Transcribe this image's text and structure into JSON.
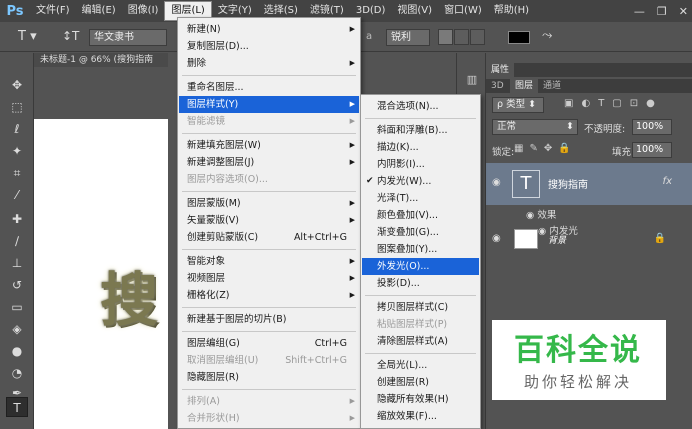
{
  "app": {
    "logo": "Ps"
  },
  "menubar": {
    "items": [
      "文件(F)",
      "编辑(E)",
      "图像(I)",
      "图层(L)",
      "文字(Y)",
      "选择(S)",
      "滤镜(T)",
      "3D(D)",
      "视图(V)",
      "窗口(W)",
      "帮助(H)"
    ],
    "active_index": 3
  },
  "options": {
    "font_family": "华文隶书",
    "aa_label": "a",
    "aa_method": "锐利"
  },
  "document": {
    "tab_title": "未标题-1 @ 66% (搜狗指南",
    "canvas_text": "搜"
  },
  "layer_menu": {
    "items": [
      {
        "label": "新建(N)",
        "arrow": true
      },
      {
        "label": "复制图层(D)..."
      },
      {
        "label": "删除",
        "arrow": true
      },
      {
        "sep": true
      },
      {
        "label": "重命名图层..."
      },
      {
        "label": "图层样式(Y)",
        "arrow": true,
        "highlighted": true
      },
      {
        "label": "智能滤镜",
        "arrow": true,
        "disabled": true
      },
      {
        "sep": true
      },
      {
        "label": "新建填充图层(W)",
        "arrow": true
      },
      {
        "label": "新建调整图层(J)",
        "arrow": true
      },
      {
        "label": "图层内容选项(O)...",
        "disabled": true
      },
      {
        "sep": true
      },
      {
        "label": "图层蒙版(M)",
        "arrow": true
      },
      {
        "label": "矢量蒙版(V)",
        "arrow": true
      },
      {
        "label": "创建剪贴蒙版(C)",
        "shortcut": "Alt+Ctrl+G"
      },
      {
        "sep": true
      },
      {
        "label": "智能对象",
        "arrow": true
      },
      {
        "label": "视频图层",
        "arrow": true
      },
      {
        "label": "栅格化(Z)",
        "arrow": true
      },
      {
        "sep": true
      },
      {
        "label": "新建基于图层的切片(B)"
      },
      {
        "sep": true
      },
      {
        "label": "图层编组(G)",
        "shortcut": "Ctrl+G"
      },
      {
        "label": "取消图层编组(U)",
        "shortcut": "Shift+Ctrl+G",
        "disabled": true
      },
      {
        "label": "隐藏图层(R)"
      },
      {
        "sep": true
      },
      {
        "label": "排列(A)",
        "arrow": true,
        "disabled": true
      },
      {
        "label": "合并形状(H)",
        "arrow": true,
        "disabled": true
      }
    ]
  },
  "style_submenu": {
    "items": [
      {
        "label": "混合选项(N)..."
      },
      {
        "sep": true
      },
      {
        "label": "斜面和浮雕(B)..."
      },
      {
        "label": "描边(K)..."
      },
      {
        "label": "内阴影(I)..."
      },
      {
        "label": "内发光(W)...",
        "checked": true
      },
      {
        "label": "光泽(T)..."
      },
      {
        "label": "颜色叠加(V)..."
      },
      {
        "label": "渐变叠加(G)..."
      },
      {
        "label": "图案叠加(Y)..."
      },
      {
        "label": "外发光(O)...",
        "highlighted": true
      },
      {
        "label": "投影(D)..."
      },
      {
        "sep": true
      },
      {
        "label": "拷贝图层样式(C)"
      },
      {
        "label": "粘贴图层样式(P)",
        "disabled": true
      },
      {
        "label": "清除图层样式(A)"
      },
      {
        "sep": true
      },
      {
        "label": "全局光(L)..."
      },
      {
        "label": "创建图层(R)"
      },
      {
        "label": "隐藏所有效果(H)"
      },
      {
        "label": "缩放效果(F)..."
      }
    ]
  },
  "panel": {
    "top_tab": "属性",
    "tabs": [
      "3D",
      "图层",
      "通道"
    ],
    "active_tab": 1,
    "filter": "类型",
    "blend_mode": "正常",
    "opacity_label": "不透明度:",
    "opacity": "100%",
    "lock_label": "锁定:",
    "fill_label": "填充:",
    "fill": "100%",
    "layers": {
      "text_layer": "搜狗指南",
      "fx": "fx",
      "effects_label": "效果",
      "effect_item": "内发光",
      "background": "背景"
    }
  },
  "watermark": {
    "title": "百科全说",
    "subtitle": "助你轻松解决"
  },
  "colors": {
    "menu_highlight": "#1a63d8",
    "watermark_green": "#35b84a",
    "selected_layer": "#6c7a8d"
  }
}
